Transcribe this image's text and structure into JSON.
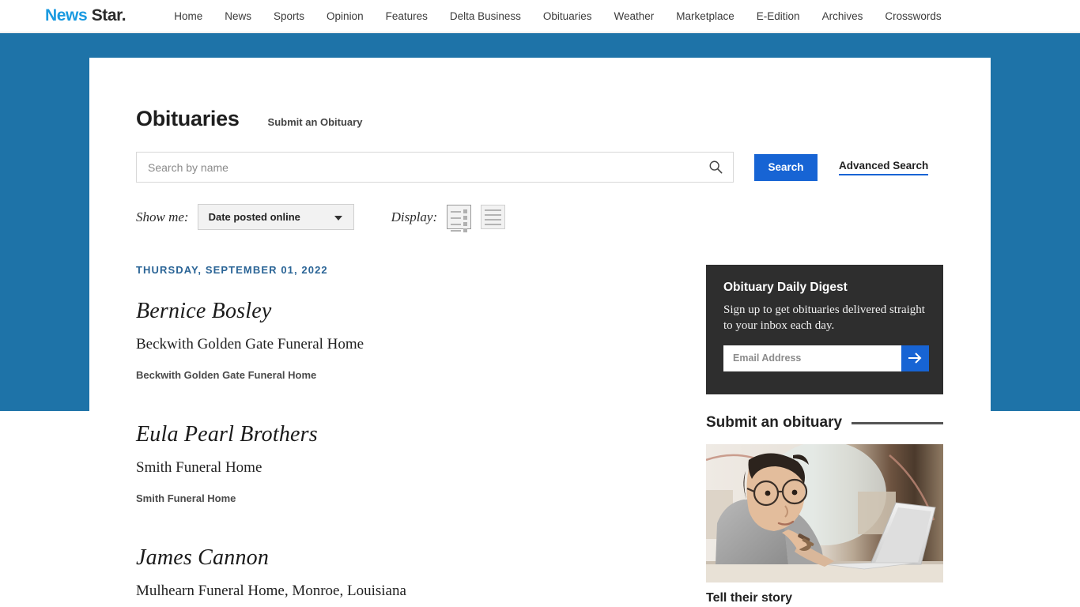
{
  "header": {
    "logo": {
      "part1": "News",
      "part2": "Star."
    },
    "nav": [
      {
        "label": "Home"
      },
      {
        "label": "News"
      },
      {
        "label": "Sports"
      },
      {
        "label": "Opinion"
      },
      {
        "label": "Features"
      },
      {
        "label": "Delta Business"
      },
      {
        "label": "Obituaries"
      },
      {
        "label": "Weather"
      },
      {
        "label": "Marketplace"
      },
      {
        "label": "E-Edition"
      },
      {
        "label": "Archives"
      },
      {
        "label": "Crosswords"
      }
    ]
  },
  "page": {
    "title": "Obituaries",
    "submit_link": "Submit an Obituary"
  },
  "search": {
    "placeholder": "Search by name",
    "value": "",
    "button_label": "Search",
    "advanced_label": "Advanced Search",
    "icon": "search-icon"
  },
  "filters": {
    "showme_label": "Show me:",
    "showme_value": "Date posted online",
    "showme_options": [
      "Date posted online"
    ],
    "display_label": "Display:",
    "display_modes": [
      {
        "name": "grid-view",
        "active": true
      },
      {
        "name": "list-view",
        "active": false
      }
    ]
  },
  "obituaries": {
    "date_heading": "THURSDAY, SEPTEMBER 01, 2022",
    "entries": [
      {
        "name": "Bernice Bosley",
        "funeral_home": "Beckwith Golden Gate Funeral Home",
        "funeral_home_bold": "Beckwith Golden Gate Funeral Home"
      },
      {
        "name": "Eula Pearl Brothers",
        "funeral_home": "Smith Funeral Home",
        "funeral_home_bold": "Smith Funeral Home"
      },
      {
        "name": "James Cannon",
        "funeral_home": "Mulhearn Funeral Home, Monroe, Louisiana",
        "funeral_home_bold": ""
      }
    ]
  },
  "sidebar": {
    "digest": {
      "title": "Obituary Daily Digest",
      "description": "Sign up to get obituaries delivered straight to your inbox each day.",
      "email_placeholder": "Email Address",
      "email_value": "",
      "submit_icon": "arrow-right-icon"
    },
    "submit_section": {
      "title": "Submit an obituary",
      "caption": "Tell their story",
      "photo_alt": "woman-at-laptop-photo"
    }
  },
  "colors": {
    "brand_blue": "#1e73a8",
    "logo_blue": "#1a9ae0",
    "accent_blue": "#1764d4",
    "date_blue": "#2a6496",
    "dark_panel": "#2e2e2e"
  }
}
